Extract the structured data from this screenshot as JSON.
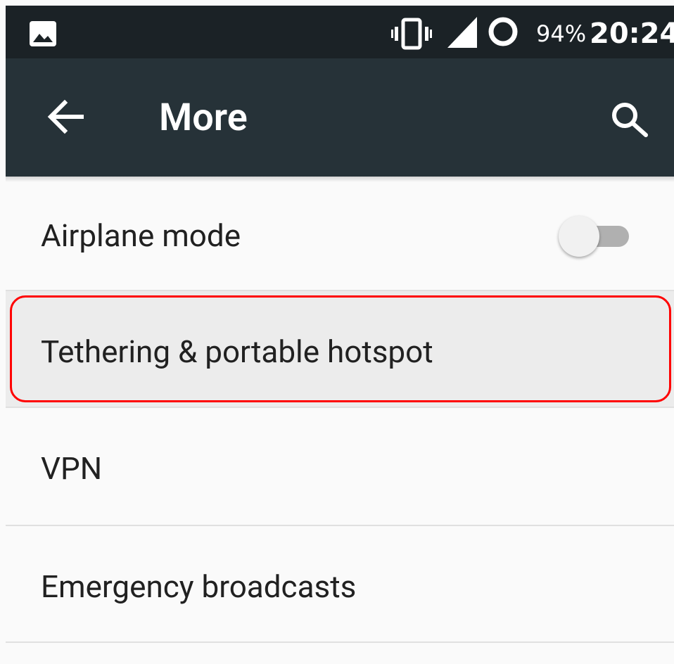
{
  "status_bar": {
    "battery": "94%",
    "time": "20:24",
    "icons": [
      "image-icon",
      "vibrate-icon",
      "signal-icon",
      "sync-ring-icon"
    ]
  },
  "app_bar": {
    "title": "More",
    "back_icon": "arrow-back-icon",
    "search_icon": "search-icon"
  },
  "items": [
    {
      "label": "Airplane mode",
      "toggle": false
    },
    {
      "label": "Tethering & portable hotspot",
      "highlighted": true
    },
    {
      "label": "VPN"
    },
    {
      "label": "Emergency broadcasts"
    }
  ],
  "colors": {
    "status_bar": "#1b2226",
    "app_bar": "#263238",
    "background": "#fafafa",
    "highlight_border": "#ff0000"
  }
}
